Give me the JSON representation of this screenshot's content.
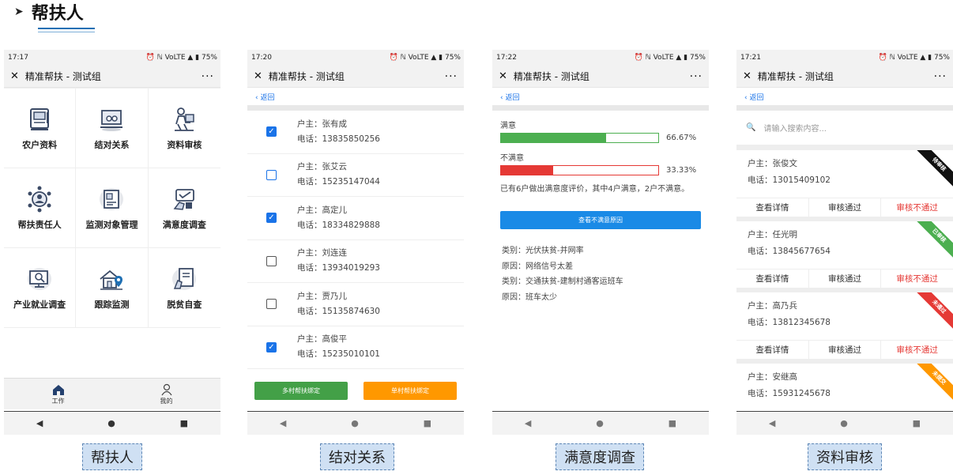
{
  "heading": {
    "arrow": "➤",
    "title": "帮扶人"
  },
  "phone1": {
    "status": {
      "time": "17:17",
      "icons": "⏰ ℕ VoLTE ▲ ▮ 75%"
    },
    "titlebar": {
      "close": "✕",
      "title": "精准帮扶 - 测试组",
      "more": "···"
    },
    "grid": [
      {
        "label": "农户资料",
        "icon": "farmer-file-icon"
      },
      {
        "label": "结对关系",
        "icon": "pairing-icon"
      },
      {
        "label": "资料审核",
        "icon": "audit-icon"
      },
      {
        "label": "帮扶责任人",
        "icon": "responsible-person-icon"
      },
      {
        "label": "监测对象管理",
        "icon": "monitor-management-icon"
      },
      {
        "label": "满意度调查",
        "icon": "satisfaction-icon"
      },
      {
        "label": "产业就业调查",
        "icon": "industry-survey-icon"
      },
      {
        "label": "跟踪监测",
        "icon": "tracking-icon"
      },
      {
        "label": "脱贫自查",
        "icon": "self-check-icon"
      }
    ],
    "tabs": [
      {
        "label": "工作",
        "icon": "home-icon"
      },
      {
        "label": "我的",
        "icon": "user-icon"
      }
    ],
    "nav": {
      "back": "◀",
      "home": "●",
      "recent": "■"
    },
    "caption": "帮扶人"
  },
  "phone2": {
    "status": {
      "time": "17:20",
      "icons": "⏰ ℕ VoLTE ▲ ▮ 75%"
    },
    "titlebar": {
      "close": "✕",
      "title": "精准帮扶 - 测试组",
      "more": "···"
    },
    "back": "‹ 返回",
    "households": [
      {
        "owner": "户主：张有成",
        "phone": "电话：13835850256",
        "checked": true,
        "style": "blue"
      },
      {
        "owner": "户主：张艾云",
        "phone": "电话：15235147044",
        "checked": false,
        "style": "blue"
      },
      {
        "owner": "户主：高定儿",
        "phone": "电话：18334829888",
        "checked": true,
        "style": "blue"
      },
      {
        "owner": "户主：刘连连",
        "phone": "电话：13934019293",
        "checked": false,
        "style": "grey"
      },
      {
        "owner": "户主：贾乃儿",
        "phone": "电话：15135874630",
        "checked": false,
        "style": "grey"
      },
      {
        "owner": "户主：高俊平",
        "phone": "电话：15235010101",
        "checked": true,
        "style": "blue"
      }
    ],
    "buttons": {
      "multi": "多村帮扶绑定",
      "single": "单村帮扶绑定"
    },
    "colors": {
      "multi": "#43a047",
      "single": "#ff9800"
    },
    "nav": {
      "back": "◀",
      "home": "●",
      "recent": "■"
    },
    "caption": "结对关系"
  },
  "phone3": {
    "status": {
      "time": "17:22",
      "icons": "⏰ ℕ VoLTE ▲ ▮ 75%"
    },
    "titlebar": {
      "close": "✕",
      "title": "精准帮扶 - 测试组",
      "more": "···"
    },
    "back": "‹ 返回",
    "satisfied": {
      "label": "满意",
      "percent_text": "66.67%",
      "fraction": 0.6667,
      "color": "#4caf50"
    },
    "unsatisfied": {
      "label": "不满意",
      "percent_text": "33.33%",
      "fraction": 0.3333,
      "color": "#e53935"
    },
    "summary": "已有6户做出满意度评价，其中4户满意，2户不满意。",
    "button": "查看不满意原因",
    "reasons": [
      "类别：光伏扶贫-并网率",
      "原因：网络信号太差",
      "类别：交通扶贫-建制村通客运班车",
      "原因：班车太少"
    ],
    "nav": {
      "back": "◀",
      "home": "●",
      "recent": "■"
    },
    "caption": "满意度调查"
  },
  "phone4": {
    "status": {
      "time": "17:21",
      "icons": "⏰ ℕ VoLTE ▲ ▮ 75%"
    },
    "titlebar": {
      "close": "✕",
      "title": "精准帮扶 - 测试组",
      "more": "···"
    },
    "back": "‹ 返回",
    "search": {
      "icon": "🔍",
      "placeholder": "请输入搜索内容..."
    },
    "cards": [
      {
        "owner": "户主：张俊文",
        "phone": "电话：13015409102",
        "ribbon": "待审核",
        "ribbon_color": "#111111"
      },
      {
        "owner": "户主：任光明",
        "phone": "电话：13845677654",
        "ribbon": "已审核",
        "ribbon_color": "#4caf50"
      },
      {
        "owner": "户主：高乃兵",
        "phone": "电话：13812345678",
        "ribbon": "未通过",
        "ribbon_color": "#e53935"
      },
      {
        "owner": "户主：安继高",
        "phone": "电话：15931245678",
        "ribbon": "未提交",
        "ribbon_color": "#ff9800"
      }
    ],
    "actions": {
      "view": "查看详情",
      "pass": "审核通过",
      "fail": "审核不通过"
    },
    "nav": {
      "back": "◀",
      "home": "●",
      "recent": "■"
    },
    "caption": "资料审核"
  }
}
